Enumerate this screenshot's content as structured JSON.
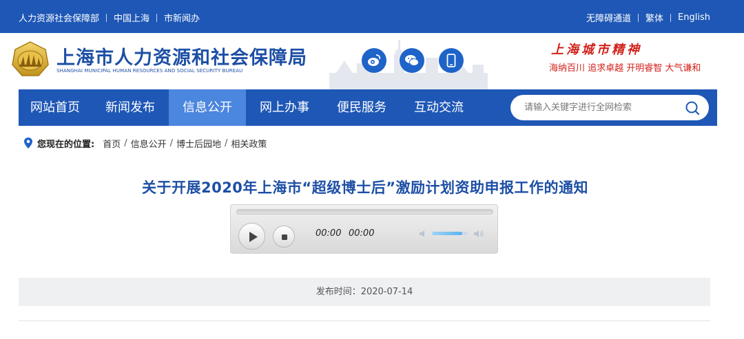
{
  "topbar": {
    "links_left": [
      "人力资源社会保障部",
      "中国上海",
      "市新闻办"
    ],
    "links_right": [
      "无障碍通道",
      "繁体",
      "English"
    ]
  },
  "header": {
    "org_name_cn": "上海市人力资源和社会保障局",
    "org_name_en": "SHANGHAI MUNICIPAL HUMAN RESOURCES AND SOCIAL SECURITY BUREAU",
    "social_icons": [
      "weibo-icon",
      "wechat-icon",
      "mobile-icon"
    ],
    "city_spirit_title": "上海城市精神",
    "city_spirit_text": "海纳百川  追求卓越  开明睿智  大气谦和"
  },
  "nav": {
    "items": [
      "网站首页",
      "新闻发布",
      "信息公开",
      "网上办事",
      "便民服务",
      "互动交流"
    ],
    "active": "信息公开",
    "search_placeholder": "请输入关键字进行全网检索"
  },
  "breadcrumb": {
    "label": "您现在的位置:",
    "items": [
      "首页",
      "信息公开",
      "博士后园地",
      "相关政策"
    ]
  },
  "article": {
    "title": "关于开展2020年上海市“超级博士后”激励计划资助申报工作的通知"
  },
  "player": {
    "current_time": "00:00",
    "duration": "00:00",
    "progress": 0,
    "volume": 0.85
  },
  "publish": {
    "text": "发布时间：2020-07-14"
  },
  "colors": {
    "primary_blue": "#1e57b6",
    "active_nav": "#4b86df",
    "title_blue": "#1d4fa5",
    "spirit_red": "#d2211b"
  }
}
